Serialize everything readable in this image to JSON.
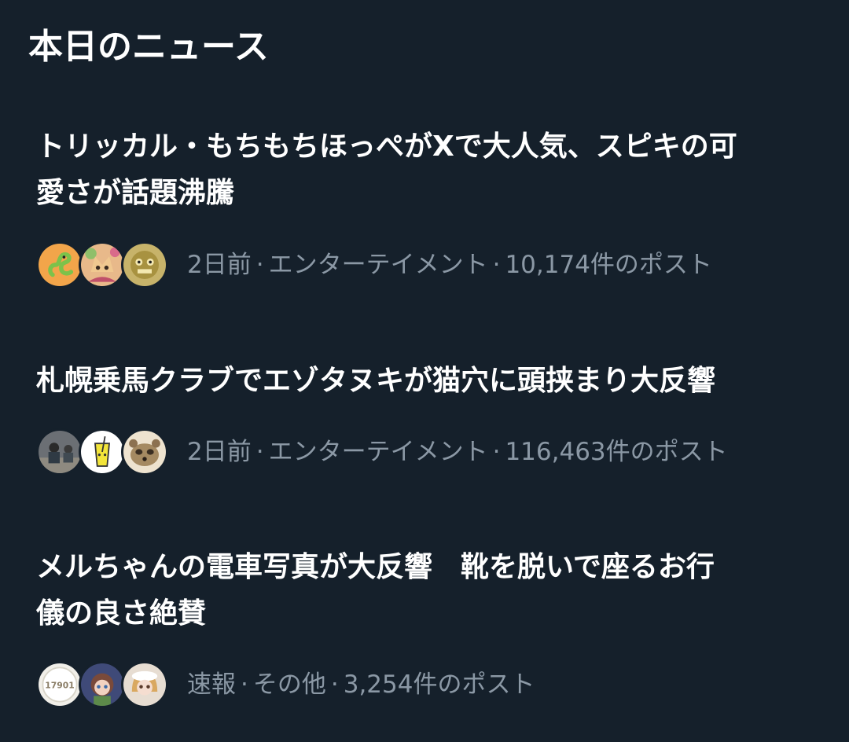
{
  "section": {
    "title": "本日のニュース"
  },
  "news": [
    {
      "headline_line1": "トリッカル・もちもちほっぺがXで大人気、スピキの可",
      "headline_line2": "愛さが話題沸騰",
      "time": "2日前",
      "category": "エンターテイメント",
      "posts": "10,174件のポスト",
      "avatars": [
        "green-snake-avatar",
        "cat-girl-avatar",
        "gold-monster-avatar"
      ]
    },
    {
      "headline_line1": "札幌乗馬クラブでエゾタヌキが猫穴に頭挟まり大反響",
      "headline_line2": "",
      "time": "2日前",
      "category": "エンターテイメント",
      "posts": "116,463件のポスト",
      "avatars": [
        "people-photo-avatar",
        "lemonade-avatar",
        "raccoon-dog-avatar"
      ]
    },
    {
      "headline_line1": "メルちゃんの電車写真が大反響　靴を脱いで座るお行",
      "headline_line2": "儀の良さ絶賛",
      "time": "速報",
      "category": "その他",
      "posts": "3,254件のポスト",
      "avatars": [
        "17901-badge-avatar",
        "doll-photo-avatar",
        "blonde-doll-avatar"
      ]
    }
  ],
  "avatar_badge_text": "17901",
  "colors": {
    "background": "#15202b",
    "headline": "#ffffff",
    "meta": "#8b98a5"
  }
}
